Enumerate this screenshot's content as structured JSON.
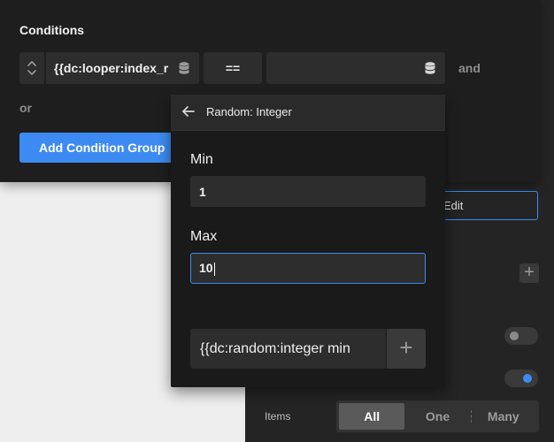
{
  "conditions": {
    "title": "Conditions",
    "key_value": "{{dc:looper:index_r",
    "operator": "==",
    "value": "",
    "and_label": "and",
    "or_label": "or",
    "add_group_label": "Add Condition Group"
  },
  "background": {
    "edit_label": "Edit",
    "plus_label": "+",
    "items_label": "Items",
    "segments": [
      "All",
      "One",
      "Many"
    ],
    "active_segment": "All",
    "toggle_a_on": false,
    "toggle_b_on": true
  },
  "random_popup": {
    "title": "Random: Integer",
    "min_label": "Min",
    "min_value": "1",
    "max_label": "Max",
    "max_value": "10",
    "tag_preview": "{{dc:random:integer min",
    "add_label": "+"
  },
  "colors": {
    "accent": "#3d8bf2",
    "panel": "#1e1e1e",
    "field": "#2d2d2d"
  },
  "icons": [
    "sort-icon",
    "database-icon",
    "back-arrow-icon",
    "plus-icon"
  ]
}
